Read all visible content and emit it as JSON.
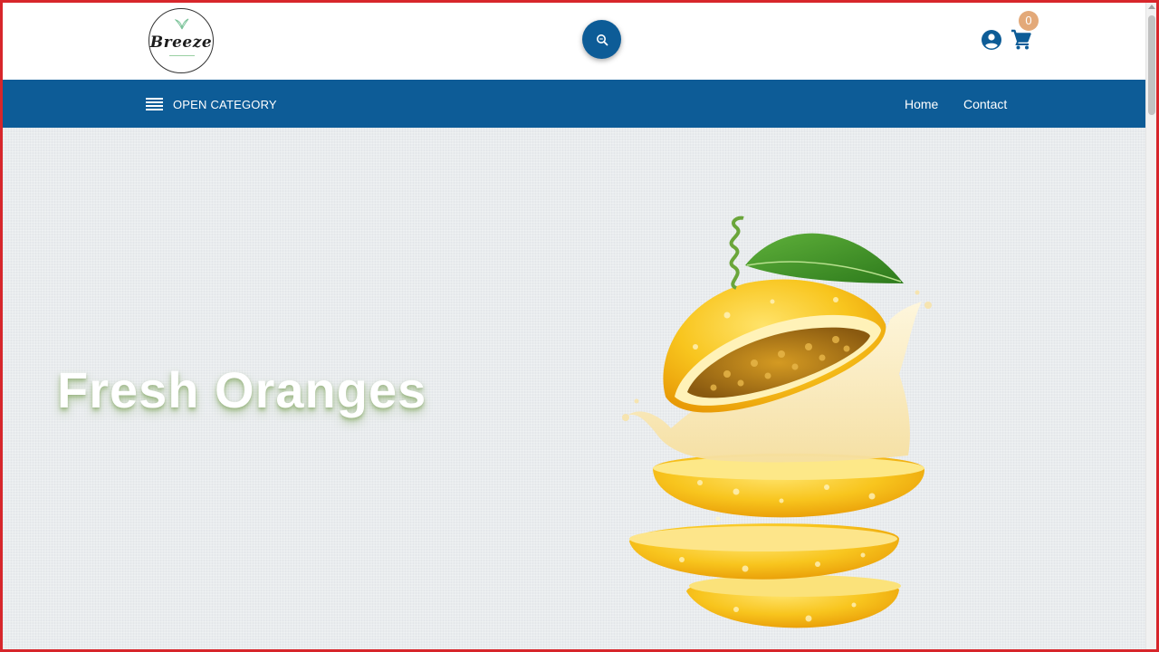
{
  "header": {
    "logo_text": "Breeze",
    "search_icon": "search-icon",
    "account_icon": "account-circle-icon",
    "cart_icon": "shopping-cart-icon",
    "cart_count": "0",
    "badge_color": "#e3a979"
  },
  "nav": {
    "category_label": "OPEN CATEGORY",
    "links": [
      {
        "label": "Home"
      },
      {
        "label": "Contact"
      }
    ],
    "bar_color": "#0d5c97"
  },
  "hero": {
    "title": "Fresh Oranges",
    "image_icon": "sliced-orange-splash-illustration"
  }
}
